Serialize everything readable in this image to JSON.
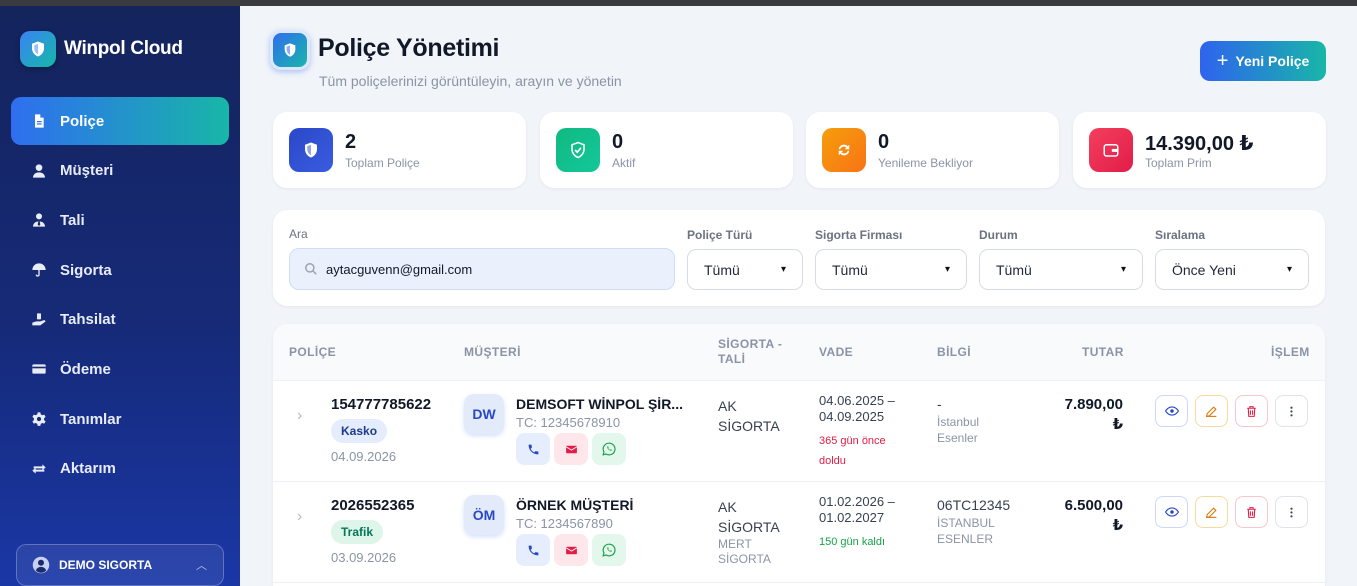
{
  "app": {
    "name": "Winpol Cloud"
  },
  "sidebar": {
    "items": [
      {
        "label": "Poliçe",
        "icon": "document-icon"
      },
      {
        "label": "Müşteri",
        "icon": "user-icon"
      },
      {
        "label": "Tali",
        "icon": "user-tie-icon"
      },
      {
        "label": "Sigorta",
        "icon": "umbrella-icon"
      },
      {
        "label": "Tahsilat",
        "icon": "hand-money-icon"
      },
      {
        "label": "Ödeme",
        "icon": "credit-card-icon"
      },
      {
        "label": "Tanımlar",
        "icon": "gear-icon"
      },
      {
        "label": "Aktarım",
        "icon": "exchange-icon"
      }
    ],
    "user": {
      "name": "DEMO SIGORTA"
    }
  },
  "header": {
    "title": "Poliçe Yönetimi",
    "subtitle": "Tüm poliçelerinizi görüntüleyin, arayın ve yönetin",
    "new_button": "Yeni Poliçe"
  },
  "stats": [
    {
      "value": "2",
      "label": "Toplam Poliçe",
      "color": "#2f4fd0"
    },
    {
      "value": "0",
      "label": "Aktif",
      "color": "#10b981"
    },
    {
      "value": "0",
      "label": "Yenileme Bekliyor",
      "color": "#f59e0b"
    },
    {
      "value": "14.390,00 ₺",
      "label": "Toplam Prim",
      "color": "#e11d48"
    }
  ],
  "filters": {
    "search_label": "Ara",
    "search_value": "aytacguvenn@gmail.com",
    "policy_type_label": "Poliçe Türü",
    "policy_type_value": "Tümü",
    "insurer_label": "Sigorta Firması",
    "insurer_value": "Tümü",
    "status_label": "Durum",
    "status_value": "Tümü",
    "sort_label": "Sıralama",
    "sort_value": "Önce Yeni"
  },
  "table": {
    "headers": {
      "policy": "POLİÇE",
      "customer": "MÜŞTERİ",
      "insurer_line1": "SİGORTA -",
      "insurer_line2": "TALİ",
      "term": "VADE",
      "info": "BİLGİ",
      "amount": "TUTAR",
      "action": "İŞLEM"
    },
    "rows": [
      {
        "policy_no": "154777785622",
        "type": "Kasko",
        "date": "04.09.2026",
        "initials": "DW",
        "customer": "DEMSOFT WİNPOL ŞİR...",
        "tc": "TC: 12345678910",
        "insurer_line1": "AK",
        "insurer_line2": "SİGORTA",
        "agent_line1": "",
        "agent_line2": "",
        "term_line1": "04.06.2025 –",
        "term_line2": "04.09.2025",
        "term_note_line1": "365 gün önce",
        "term_note_line2": "doldu",
        "info_main": "-",
        "info_line1": "İstanbul",
        "info_line2": "Esenler",
        "amount_line1": "7.890,00",
        "amount_line2": "₺"
      },
      {
        "policy_no": "2026552365",
        "type": "Trafik",
        "date": "03.09.2026",
        "initials": "ÖM",
        "customer": "ÖRNEK MÜŞTERİ",
        "tc": "TC: 1234567890",
        "insurer_line1": "AK",
        "insurer_line2": "SİGORTA",
        "agent_line1": "MERT",
        "agent_line2": "SİGORTA",
        "term_line1": "01.02.2026 –",
        "term_line2": "01.02.2027",
        "term_note_line1": "150 gün kaldı",
        "term_note_line2": "",
        "info_main": "06TC12345",
        "info_line1": "İSTANBUL",
        "info_line2": "ESENLER",
        "amount_line1": "6.500,00",
        "amount_line2": "₺"
      }
    ]
  }
}
